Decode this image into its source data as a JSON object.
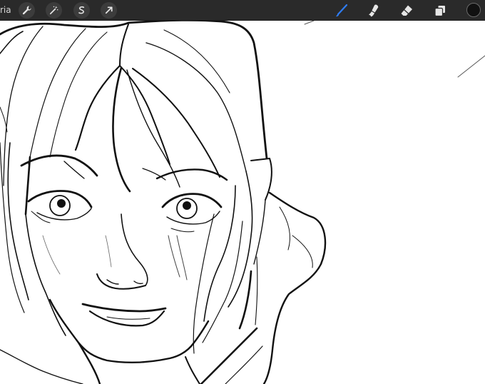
{
  "app": {
    "gallery_label": "ria"
  },
  "toolbar": {
    "left_tools": [
      {
        "icon": "wrench-icon",
        "name": "actions-button"
      },
      {
        "icon": "magic-wand-icon",
        "name": "adjustments-button"
      },
      {
        "icon": "selection-s-icon",
        "name": "selection-button"
      },
      {
        "icon": "arrow-cursor-icon",
        "name": "transform-button"
      }
    ],
    "right_tools": [
      {
        "icon": "brush-icon",
        "name": "brush-button",
        "active": true
      },
      {
        "icon": "smudge-icon",
        "name": "smudge-button"
      },
      {
        "icon": "eraser-icon",
        "name": "eraser-button"
      },
      {
        "icon": "layers-icon",
        "name": "layers-button"
      }
    ]
  },
  "colors": {
    "toolbar_bg": "#2a2a2a",
    "icon_light": "#e6e6e6",
    "active_tool": "#2f7df6",
    "current_color": "#111111",
    "ink": "#111111"
  },
  "canvas": {
    "content": "sketch"
  }
}
